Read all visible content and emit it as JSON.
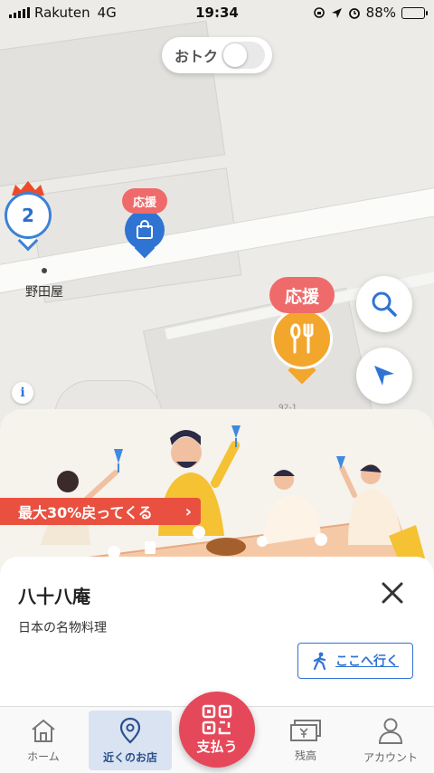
{
  "status_bar": {
    "carrier": "Rakuten",
    "network": "4G",
    "time": "19:34",
    "battery": "88%",
    "battery_level": 0.88
  },
  "otoku_toggle": {
    "label": "おトク",
    "on": false
  },
  "map": {
    "cluster_count": "2",
    "shopping_badge": "応援",
    "restaurant_badge": "応援",
    "poi_label": "野田屋",
    "address_label": "92-1",
    "info_label": "i"
  },
  "promo": {
    "text": "最大30%戻ってくる",
    "chevron": "›"
  },
  "shop": {
    "name": "八十八庵",
    "category": "日本の名物料理",
    "directions_label": "ここへ行く"
  },
  "tabs": [
    {
      "label": "ホーム",
      "icon": "home-icon"
    },
    {
      "label": "近くのお店",
      "icon": "map-pin-icon",
      "active": true
    },
    {
      "label": "支払う",
      "icon": "qr-icon"
    },
    {
      "label": "残高",
      "icon": "cash-icon"
    },
    {
      "label": "アカウント",
      "icon": "person-icon"
    }
  ],
  "colors": {
    "accent_blue": "#2f74d3",
    "promo_red": "#e9503f",
    "pay_red": "#e5485a",
    "pin_orange": "#f3a62c",
    "badge_pink": "#ef6a6a"
  }
}
